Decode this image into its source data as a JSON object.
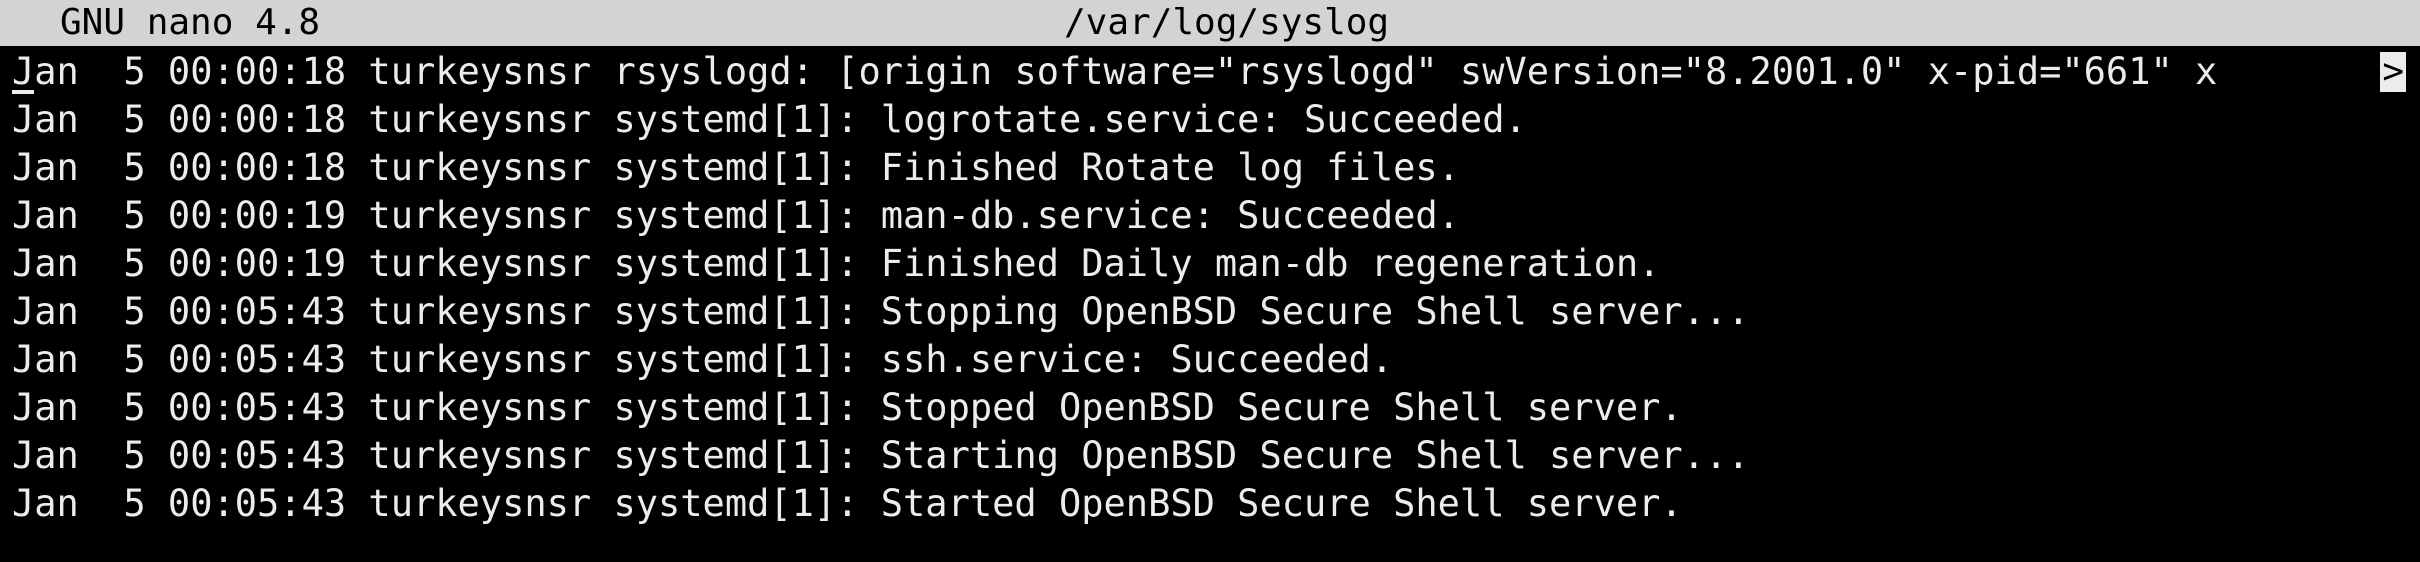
{
  "titlebar": {
    "app": "GNU nano 4.8",
    "filename": "/var/log/syslog"
  },
  "lines": [
    "Jan  5 00:00:18 turkeysnsr rsyslogd: [origin software=\"rsyslogd\" swVersion=\"8.2001.0\" x-pid=\"661\" x",
    "Jan  5 00:00:18 turkeysnsr systemd[1]: logrotate.service: Succeeded.",
    "Jan  5 00:00:18 turkeysnsr systemd[1]: Finished Rotate log files.",
    "Jan  5 00:00:19 turkeysnsr systemd[1]: man-db.service: Succeeded.",
    "Jan  5 00:00:19 turkeysnsr systemd[1]: Finished Daily man-db regeneration.",
    "Jan  5 00:05:43 turkeysnsr systemd[1]: Stopping OpenBSD Secure Shell server...",
    "Jan  5 00:05:43 turkeysnsr systemd[1]: ssh.service: Succeeded.",
    "Jan  5 00:05:43 turkeysnsr systemd[1]: Stopped OpenBSD Secure Shell server.",
    "Jan  5 00:05:43 turkeysnsr systemd[1]: Starting OpenBSD Secure Shell server...",
    "Jan  5 00:05:43 turkeysnsr systemd[1]: Started OpenBSD Secure Shell server."
  ],
  "overflow_marker": ">",
  "colors": {
    "titlebar_bg": "#d3d3d3",
    "titlebar_fg": "#000000",
    "editor_bg": "#000000",
    "editor_fg": "#ececec"
  }
}
